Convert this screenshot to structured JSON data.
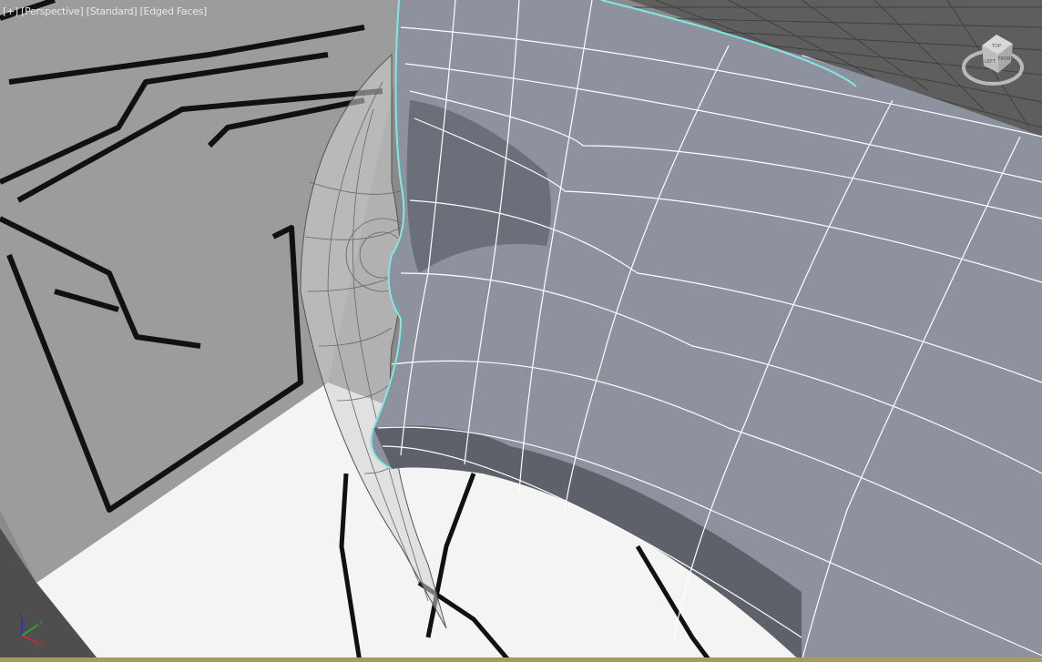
{
  "viewport": {
    "menu_plus": "[+]",
    "view_mode": "[Perspective]",
    "shading_mode": "[Standard]",
    "display_mode": "[Edged Faces]"
  },
  "viewcube": {
    "top": "TOP",
    "front": "FRONT",
    "left": "LEFT"
  },
  "axis_tripod": {
    "x": "x",
    "y": "y",
    "z": "z"
  },
  "colors": {
    "selection_outline": "#7fe8e8",
    "mesh": "#8e929e",
    "wire": "#ffffff"
  }
}
